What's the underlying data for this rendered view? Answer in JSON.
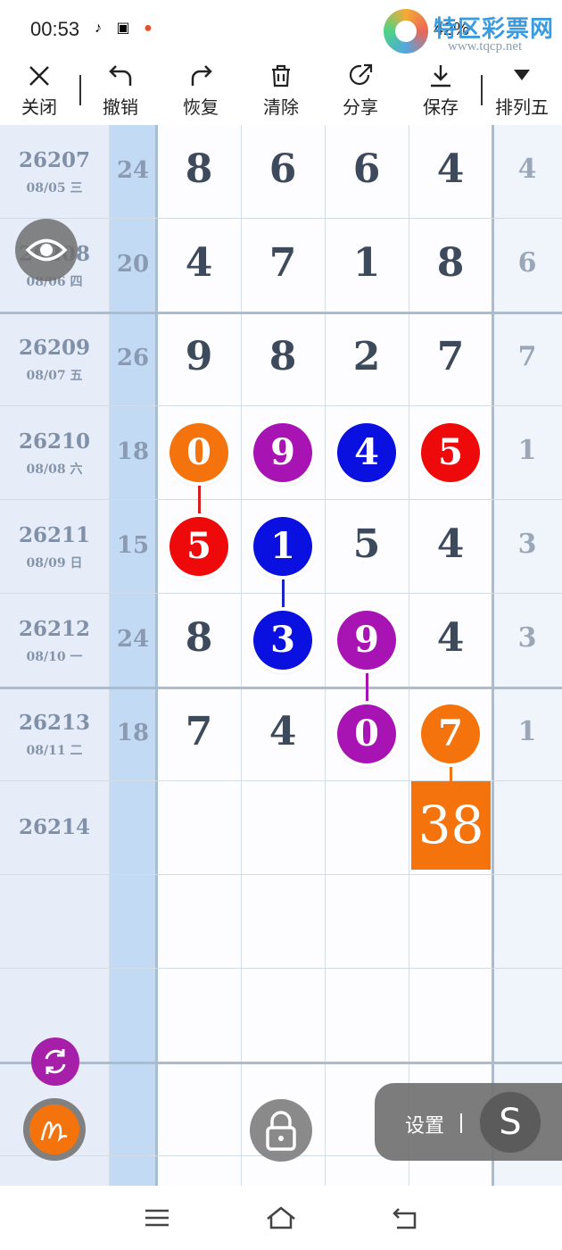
{
  "status": {
    "time": "00:53",
    "battery": "42%",
    "icons": [
      "tiktok-icon",
      "app-icon",
      "game-icon"
    ]
  },
  "watermark": {
    "title": "特区彩票网",
    "url": "www.tqcp.net"
  },
  "toolbar": {
    "items": [
      {
        "label": "关闭",
        "icon": "close-icon"
      },
      {
        "label": "撤销",
        "icon": "undo-icon"
      },
      {
        "label": "恢复",
        "icon": "redo-icon"
      },
      {
        "label": "清除",
        "icon": "trash-icon"
      },
      {
        "label": "分享",
        "icon": "share-icon"
      },
      {
        "label": "保存",
        "icon": "download-icon"
      },
      {
        "label": "排列五",
        "icon": "triangle-down-icon"
      }
    ]
  },
  "rows": [
    {
      "issue": "26207",
      "date": "08/05 三",
      "sum": "24",
      "nums": [
        "8",
        "6",
        "6",
        "4"
      ],
      "tail": "4"
    },
    {
      "issue": "26208",
      "date": "08/06 四",
      "sum": "20",
      "nums": [
        "4",
        "7",
        "1",
        "8"
      ],
      "tail": "6"
    },
    {
      "issue": "26209",
      "date": "08/07 五",
      "sum": "26",
      "nums": [
        "9",
        "8",
        "2",
        "7"
      ],
      "tail": "7"
    },
    {
      "issue": "26210",
      "date": "08/08 六",
      "sum": "18",
      "nums": [
        "0",
        "9",
        "4",
        "5"
      ],
      "tail": "1"
    },
    {
      "issue": "26211",
      "date": "08/09 日",
      "sum": "15",
      "nums": [
        "5",
        "1",
        "5",
        "4"
      ],
      "tail": "3"
    },
    {
      "issue": "26212",
      "date": "08/10 一",
      "sum": "24",
      "nums": [
        "8",
        "3",
        "9",
        "4"
      ],
      "tail": "3"
    },
    {
      "issue": "26213",
      "date": "08/11 二",
      "sum": "18",
      "nums": [
        "7",
        "4",
        "0",
        "7"
      ],
      "tail": "1"
    },
    {
      "issue": "26214",
      "date": "",
      "sum": "",
      "nums": [
        "",
        "",
        "",
        ""
      ],
      "tail": ""
    }
  ],
  "highlights": [
    {
      "row": 3,
      "col": 0,
      "color": "#f5730c"
    },
    {
      "row": 3,
      "col": 1,
      "color": "#a814b4"
    },
    {
      "row": 3,
      "col": 2,
      "color": "#0a10e0"
    },
    {
      "row": 3,
      "col": 3,
      "color": "#ee0a0a"
    },
    {
      "row": 4,
      "col": 0,
      "color": "#ee0a0a"
    },
    {
      "row": 4,
      "col": 1,
      "color": "#0a10e0"
    },
    {
      "row": 5,
      "col": 1,
      "color": "#0a10e0"
    },
    {
      "row": 5,
      "col": 2,
      "color": "#a814b4"
    },
    {
      "row": 6,
      "col": 2,
      "color": "#a814b4"
    },
    {
      "row": 6,
      "col": 3,
      "color": "#f5730c"
    }
  ],
  "connectors": [
    {
      "col": 0,
      "from_row": 3,
      "color": "#d42020"
    },
    {
      "col": 1,
      "from_row": 4,
      "color": "#1a24c8"
    },
    {
      "col": 2,
      "from_row": 5,
      "color": "#a814b4"
    },
    {
      "col": 3,
      "from_row": 6,
      "color": "#f5730c"
    }
  ],
  "result_box": {
    "value": "38",
    "color": "#f5730c"
  },
  "controls": {
    "settings_label": "设置",
    "settings_badge": "S"
  },
  "colors": {
    "orange": "#f5730c",
    "purple": "#a814b4",
    "blue": "#0a10e0",
    "red": "#ee0a0a",
    "sum_column": "#c3daf4"
  }
}
